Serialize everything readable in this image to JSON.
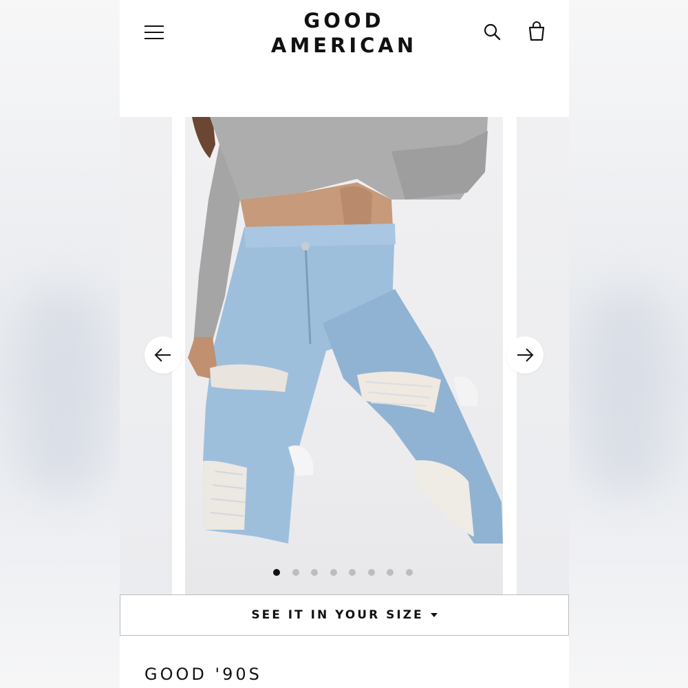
{
  "brand": {
    "line1": "GOOD",
    "line2": "AMERICAN"
  },
  "header": {
    "menu_icon": "hamburger-menu-icon",
    "search_icon": "search-icon",
    "bag_icon": "shopping-bag-icon"
  },
  "carousel": {
    "total_slides": 8,
    "active_slide": 1,
    "prev_icon": "arrow-left-icon",
    "next_icon": "arrow-right-icon",
    "image_description_icon": "product-photo"
  },
  "size_button": {
    "label": "SEE IT IN YOUR SIZE",
    "icon": "caret-down-icon"
  },
  "product": {
    "title": "GOOD '90S"
  },
  "colors": {
    "text": "#111111",
    "dot_inactive": "#bdbdbd",
    "border": "#bcbcbc",
    "denim": "#9fbfdc",
    "shirt": "#a7a7a7"
  }
}
